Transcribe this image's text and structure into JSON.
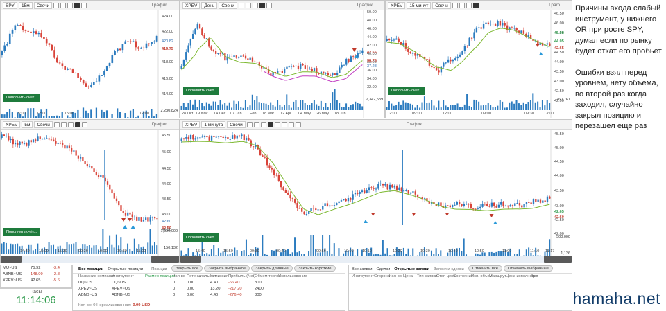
{
  "windows": [
    {
      "id": "w1",
      "ticker": "SPY",
      "timeframe": "15м",
      "chart_type": "Свечи",
      "graph_label": "График",
      "yticks": [
        {
          "v": "424.00",
          "y": 6
        },
        {
          "v": "422.00",
          "y": 28
        },
        {
          "v": "418.00",
          "y": 72
        },
        {
          "v": "416.00",
          "y": 96
        },
        {
          "v": "414.00",
          "y": 118
        }
      ],
      "price_tags": [
        {
          "v": "420.82",
          "c": "hb",
          "y": 42
        },
        {
          "v": "419.75",
          "c": "hl",
          "y": 53
        }
      ],
      "xticks": [
        {
          "v": "15:00",
          "x": 22
        },
        {
          "v": "12:00",
          "x": 52
        },
        {
          "v": "15:00",
          "x": 92
        },
        {
          "v": "12:00",
          "x": 200
        }
      ],
      "button": "Пополнить счёт...",
      "vol_max": "2,230,824"
    },
    {
      "id": "w2",
      "ticker": "XPEV",
      "timeframe": "День",
      "chart_type": "Свечи",
      "graph_label": "График",
      "yticks": [
        {
          "v": "50.00",
          "y": 0
        },
        {
          "v": "48.00",
          "y": 12
        },
        {
          "v": "46.00",
          "y": 24
        },
        {
          "v": "44.00",
          "y": 36
        },
        {
          "v": "42.00",
          "y": 48
        },
        {
          "v": "40.00",
          "y": 60
        },
        {
          "v": "38.00",
          "y": 72
        },
        {
          "v": "36.00",
          "y": 84
        },
        {
          "v": "34.00",
          "y": 96
        },
        {
          "v": "32.00",
          "y": 108
        }
      ],
      "price_tags": [
        {
          "v": "42.65",
          "c": "hl",
          "y": 58
        },
        {
          "v": "38.75",
          "c": "hl",
          "y": 70
        },
        {
          "v": "37.28",
          "c": "hb",
          "y": 78
        }
      ],
      "xticks": [
        {
          "v": "28 Oct",
          "x": 2
        },
        {
          "v": "19 Nov",
          "x": 22
        },
        {
          "v": "14 Dec",
          "x": 48
        },
        {
          "v": "07 Jan",
          "x": 72
        },
        {
          "v": "Feb",
          "x": 100
        },
        {
          "v": "18 Mar",
          "x": 118
        },
        {
          "v": "12 Apr",
          "x": 144
        },
        {
          "v": "04 May",
          "x": 170
        },
        {
          "v": "26 May",
          "x": 196
        },
        {
          "v": "18 Jun",
          "x": 222
        }
      ],
      "button": "Пополнить счёт...",
      "vol_max": "2,342,589"
    },
    {
      "id": "w3",
      "ticker": "XPEV",
      "timeframe": "15 минут",
      "chart_type": "Свечи",
      "graph_label": "Граф",
      "yticks": [
        {
          "v": "46.50",
          "y": 2
        },
        {
          "v": "46.00",
          "y": 16
        },
        {
          "v": "45.50",
          "y": 30
        },
        {
          "v": "44.50",
          "y": 58
        },
        {
          "v": "44.00",
          "y": 72
        },
        {
          "v": "43.50",
          "y": 86
        },
        {
          "v": "43.00",
          "y": 100
        },
        {
          "v": "42.50",
          "y": 114
        },
        {
          "v": "42.00",
          "y": 128
        }
      ],
      "price_tags": [
        {
          "v": "45.98",
          "c": "hg",
          "y": 30
        },
        {
          "v": "44.05",
          "c": "hg",
          "y": 42
        },
        {
          "v": "42.65",
          "c": "hl",
          "y": 52
        }
      ],
      "xticks": [
        {
          "v": "12:00",
          "x": 2
        },
        {
          "v": "09:00",
          "x": 38
        },
        {
          "v": "12:00",
          "x": 82
        },
        {
          "v": "09:00",
          "x": 138
        },
        {
          "v": "09:30",
          "x": 200
        },
        {
          "v": "13:00",
          "x": 228
        }
      ],
      "button": "Пополнить счёт...",
      "vol_max": "760,761"
    },
    {
      "id": "w4",
      "ticker": "XPEV",
      "timeframe": "5м",
      "chart_type": "Свечи",
      "graph_label": "График",
      "yticks": [
        {
          "v": "45.50",
          "y": 6
        },
        {
          "v": "45.00",
          "y": 30
        },
        {
          "v": "44.50",
          "y": 54
        },
        {
          "v": "44.00",
          "y": 76
        },
        {
          "v": "43.50",
          "y": 98
        },
        {
          "v": "43.00",
          "y": 120
        },
        {
          "v": "42.50",
          "y": 142
        }
      ],
      "price_tags": [
        {
          "v": "42.60",
          "c": "hb",
          "y": 130
        },
        {
          "v": "42.50",
          "c": "hl",
          "y": 140
        }
      ],
      "xticks": [
        {
          "v": "14:30",
          "x": 28
        },
        {
          "v": "15:00",
          "x": 55
        },
        {
          "v": "15:30",
          "x": 82
        },
        {
          "v": "09:30",
          "x": 112
        },
        {
          "v": "10:00",
          "x": 140
        },
        {
          "v": "10:30",
          "x": 168
        },
        {
          "v": "11:00",
          "x": 196
        }
      ],
      "button": "Пополнить счёт...",
      "vol_max": "1,000,000",
      "vol_mid": "150,132"
    },
    {
      "id": "w5",
      "ticker": "XPEV",
      "timeframe": "1 минута",
      "chart_type": "Свечи",
      "graph_label": "График",
      "yticks": [
        {
          "v": "45.50",
          "y": 4
        },
        {
          "v": "45.00",
          "y": 24
        },
        {
          "v": "44.50",
          "y": 44
        },
        {
          "v": "44.00",
          "y": 64
        },
        {
          "v": "43.50",
          "y": 86
        },
        {
          "v": "43.00",
          "y": 108
        },
        {
          "v": "42.50",
          "y": 128
        },
        {
          "v": "42.00",
          "y": 148
        }
      ],
      "price_tags": [
        {
          "v": "42.65",
          "c": "hg",
          "y": 116
        },
        {
          "v": "42.60",
          "c": "hl",
          "y": 124
        }
      ],
      "xticks": [
        {
          "v": "15:40",
          "x": 22
        },
        {
          "v": "15:50",
          "x": 62
        },
        {
          "v": "09:30",
          "x": 100
        },
        {
          "v": "09:40",
          "x": 138
        },
        {
          "v": "09:50",
          "x": 196
        },
        {
          "v": "10:00",
          "x": 236
        },
        {
          "v": "10:10",
          "x": 262
        },
        {
          "v": "10:20",
          "x": 306
        },
        {
          "v": "10:30",
          "x": 346
        },
        {
          "v": "10:40",
          "x": 386
        },
        {
          "v": "10:50",
          "x": 424
        },
        {
          "v": "11:00",
          "x": 464
        },
        {
          "v": "11:10",
          "x": 504
        },
        {
          "v": "11:17",
          "x": 526
        }
      ],
      "button": "Пополнить счёт...",
      "vol_max": "500,000",
      "vol_mid": "1,126"
    }
  ],
  "watchlist": [
    {
      "sym": "MU~US",
      "price": "75.92",
      "chg": "-3.4"
    },
    {
      "sym": "ABNB~US",
      "price": "148.09",
      "chg": "-2.8"
    },
    {
      "sym": "XPEV~US",
      "price": "42.65",
      "chg": "-5.6"
    }
  ],
  "clock": {
    "label": "Часы",
    "time": "11:14:06"
  },
  "positions": {
    "tabs": [
      "Все позиции",
      "Открытые позиции"
    ],
    "section": "Позиции",
    "buttons": [
      "Закрыть все",
      "Закрыть выбранное",
      "Закрыть длинные",
      "Закрыть короткие"
    ],
    "headers": [
      "Название компании",
      "Инструмент",
      "Размер позиции",
      "Кол-во",
      "Потенциальная",
      "Комиссия",
      "Прибыль (Net)",
      "Объем торгов",
      "Использование"
    ],
    "rows": [
      [
        "DQ~US",
        "DQ~US",
        "",
        "0",
        "0.00",
        "4.40",
        "-66.40",
        "800",
        ""
      ],
      [
        "XPEV~US",
        "XPEV~US",
        "",
        "0",
        "0.00",
        "13.20",
        "-217.20",
        "2400",
        ""
      ],
      [
        "ABNB~US",
        "ABNB~US",
        "",
        "0",
        "0.00",
        "4.40",
        "-276.40",
        "800",
        ""
      ]
    ],
    "footer_label": "Кол-во: 0   Нереализованная:",
    "footer_value": "0.00 USD"
  },
  "orders": {
    "tabs": [
      "Все заявки",
      "Сделки",
      "Открытые заявки"
    ],
    "section": "Заявки и сделки",
    "buttons": [
      "Отменить все",
      "Отменить выбранные"
    ],
    "headers": [
      "Инструмент",
      "Сторона",
      "Кол-во",
      "Цена",
      "Тип заявки",
      "Стоп цена",
      "Состояние",
      "Исп. объем",
      "Маршрут",
      "Цена исполнения",
      "Вре"
    ]
  },
  "notes": {
    "p1": "Причины входа слабый инструмент, у нижнего OR при росте SPY, думал если по рынку будет откат его пробьет",
    "p2": "Ошибки взял перед уровнем, нету объема, во второй раз когда заходил, случайно закрыл позицию и перезашел еще раз"
  },
  "watermark": "hamaha.net",
  "colors": {
    "up": "#2b7bbf",
    "down": "#d9443a",
    "ma": "#7cb82f",
    "ma2": "#c23fc2",
    "green_btn": "#1e7b3c"
  }
}
